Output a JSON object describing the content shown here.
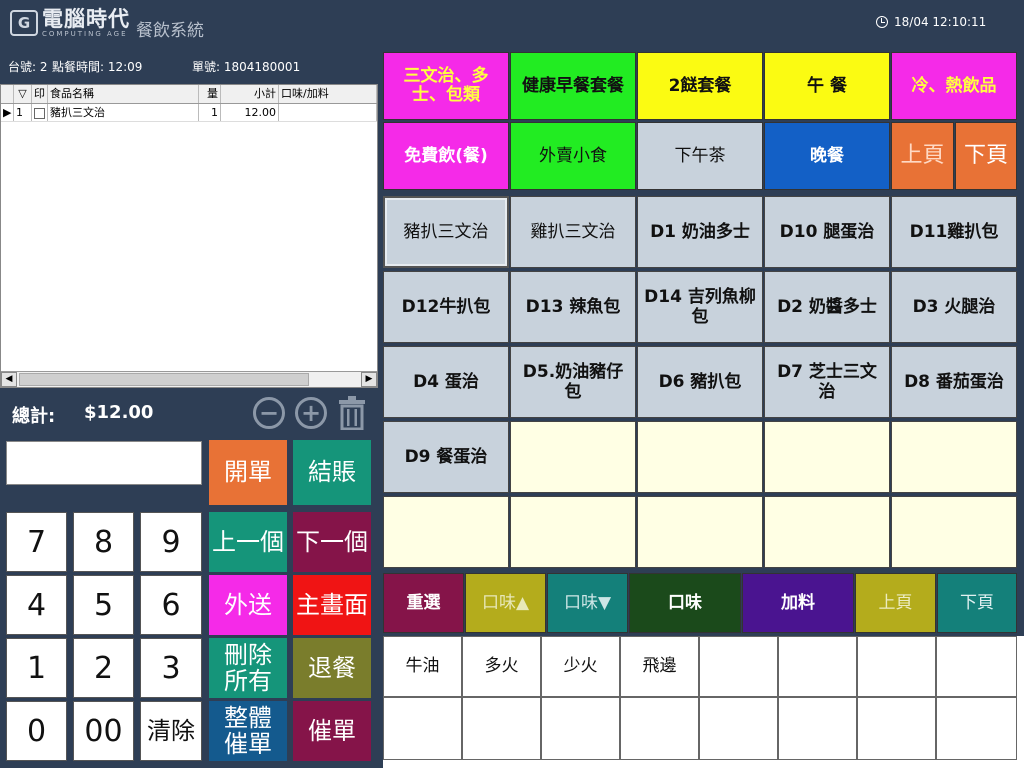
{
  "header": {
    "logo_mark": "G",
    "logo_cn": "電腦時代",
    "logo_en": "COMPUTING AGE",
    "system_name": "餐飲系統",
    "datetime": "18/04 12:10:11"
  },
  "order_info": {
    "table": "台號: 2",
    "time": "點餐時間: 12:09",
    "order_no": "單號: 1804180001"
  },
  "grid": {
    "headers": [
      "",
      "▽",
      "印",
      "食品名稱",
      "量",
      "小計",
      "口味/加料"
    ],
    "rows": [
      {
        "marker": "▶",
        "no": "1",
        "name": "豬扒三文治",
        "qty": "1",
        "subtotal": "12.00",
        "flavor": ""
      }
    ]
  },
  "total": {
    "label": "總計:",
    "value": "$12.00"
  },
  "icons": {
    "minus": "minus-circle-icon",
    "plus": "plus-circle-icon",
    "trash": "trash-icon"
  },
  "keypad": {
    "k7": "7",
    "k8": "8",
    "k9": "9",
    "k4": "4",
    "k5": "5",
    "k6": "6",
    "k1": "1",
    "k2": "2",
    "k3": "3",
    "k0": "0",
    "k00": "00",
    "clear": "清除"
  },
  "actions": {
    "open": "開單",
    "checkout": "結賬",
    "prev": "上一個",
    "next": "下一個",
    "takeout": "外送",
    "main": "主畫面",
    "delete_all": "刪除所有",
    "void": "退餐",
    "rush_all": "整體催單",
    "rush": "催單"
  },
  "categories": {
    "c1": "三文治、多士、包類",
    "c2": "健康早餐套餐",
    "c3": "2餸套餐",
    "c4": "午 餐",
    "c5": "冷、熱飲品",
    "c6": "免費飲(餐)",
    "c7": "外賣小食",
    "c8": "下午茶",
    "c9": "晚餐",
    "prev": "上頁",
    "next": "下頁"
  },
  "items": [
    "豬扒三文治",
    "雞扒三文治",
    "D1 奶油多士",
    "D10 腿蛋治",
    "D11雞扒包",
    "D12牛扒包",
    "D13 辣魚包",
    "D14 吉列魚柳包",
    "D2 奶醬多士",
    "D3 火腿治",
    "D4 蛋治",
    "D5.奶油豬仔包",
    "D6 豬扒包",
    "D7 芝士三文治",
    "D8 番茄蛋治",
    "D9 餐蛋治"
  ],
  "options_bar": {
    "reselect": "重選",
    "flavor_up": "口味▲",
    "flavor_down": "口味▼",
    "flavor": "口味",
    "addon": "加料",
    "prev": "上頁",
    "next": "下頁"
  },
  "flavors": [
    "牛油",
    "多火",
    "少火",
    "飛邊"
  ],
  "colors": {
    "bg": "#2e3e55",
    "magenta": "#f52ae8",
    "green": "#22ec22",
    "yellow": "#fbfb12",
    "blue": "#1360c6",
    "orange": "#e87236",
    "teal": "#15957a",
    "red": "#f01414",
    "maroon": "#851449",
    "olive": "#7a7d2c",
    "navy": "#145a8e",
    "item": "#c8d2dc"
  }
}
